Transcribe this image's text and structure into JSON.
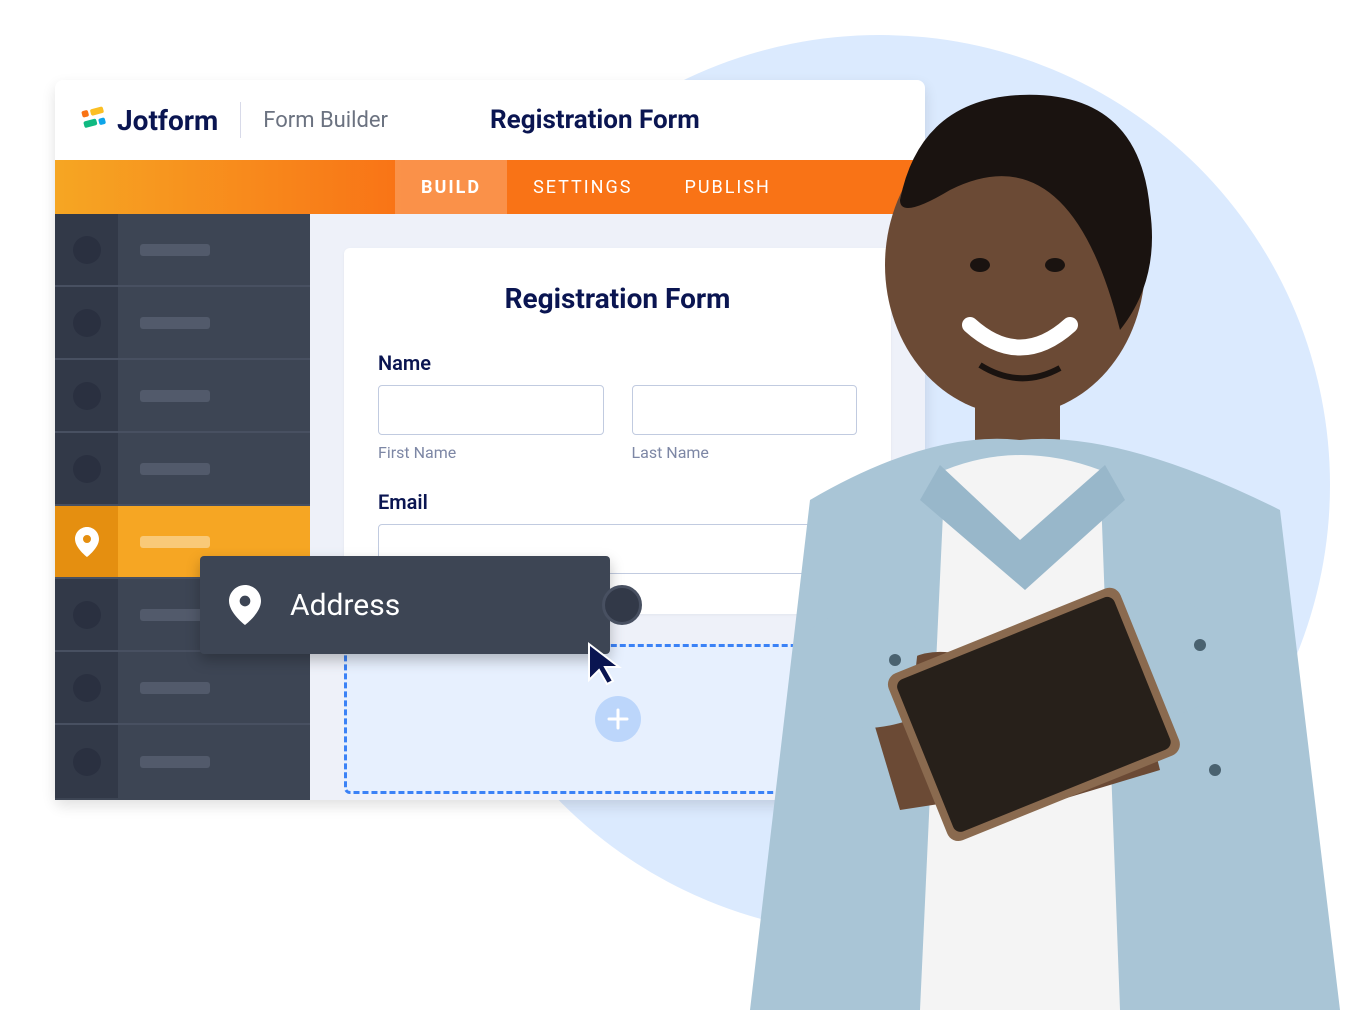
{
  "brand": {
    "name": "Jotform",
    "product": "Form Builder"
  },
  "document": {
    "title": "Registration Form"
  },
  "tabs": [
    {
      "label": "BUILD",
      "active": true
    },
    {
      "label": "SETTINGS",
      "active": false
    },
    {
      "label": "PUBLISH",
      "active": false
    }
  ],
  "palette": {
    "active_index": 4,
    "drag_item": {
      "label": "Address",
      "icon": "location-pin-icon"
    }
  },
  "form": {
    "title": "Registration Form",
    "fields": {
      "name": {
        "label": "Name",
        "first_sub": "First Name",
        "last_sub": "Last Name"
      },
      "email": {
        "label": "Email"
      }
    }
  },
  "colors": {
    "brand_dark": "#0a1551",
    "accent": "#f6a623",
    "accent_dark": "#f97316",
    "dropzone": "#3b82f6"
  }
}
